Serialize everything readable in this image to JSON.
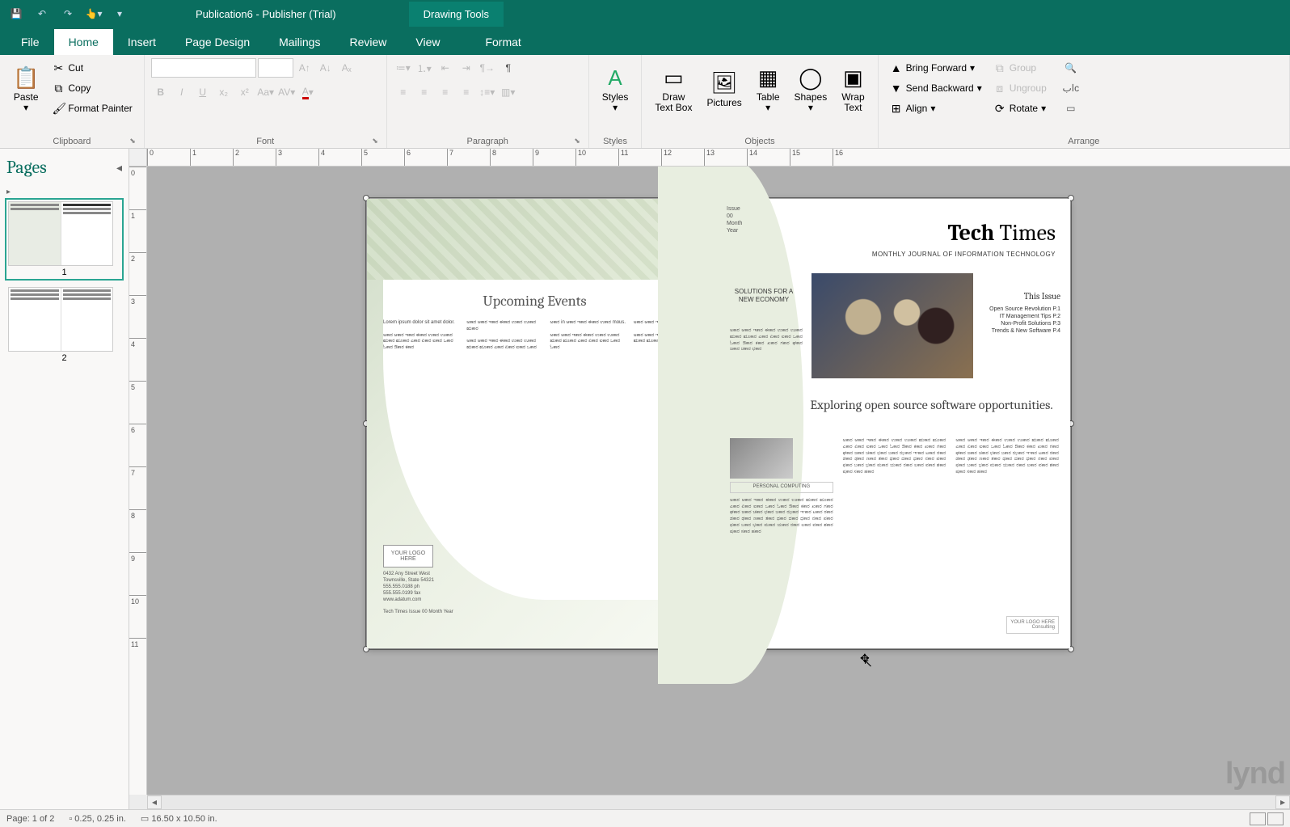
{
  "title": "Publication6 - Publisher (Trial)",
  "context_tab": "Drawing Tools",
  "tabs": {
    "file": "File",
    "home": "Home",
    "insert": "Insert",
    "page_design": "Page Design",
    "mailings": "Mailings",
    "review": "Review",
    "view": "View",
    "format": "Format"
  },
  "ribbon": {
    "clipboard": {
      "label": "Clipboard",
      "paste": "Paste",
      "cut": "Cut",
      "copy": "Copy",
      "format_painter": "Format Painter"
    },
    "font": {
      "label": "Font"
    },
    "paragraph": {
      "label": "Paragraph"
    },
    "styles": {
      "label": "Styles",
      "styles_btn": "Styles"
    },
    "objects": {
      "label": "Objects",
      "draw_text_box": "Draw\nText Box",
      "pictures": "Pictures",
      "table": "Table",
      "shapes": "Shapes",
      "wrap_text": "Wrap\nText"
    },
    "arrange": {
      "label": "Arrange",
      "bring_forward": "Bring Forward",
      "send_backward": "Send Backward",
      "align": "Align",
      "group": "Group",
      "ungroup": "Ungroup",
      "rotate": "Rotate"
    }
  },
  "pages_panel": {
    "title": "Pages",
    "page1_num": "1",
    "page2_num": "2"
  },
  "statusbar": {
    "page": "Page: 1 of 2",
    "pos": "0.25, 0.25 in.",
    "size": "16.50 x 10.50 in."
  },
  "ruler_h": [
    "0",
    "1",
    "2",
    "3",
    "4",
    "5",
    "6",
    "7",
    "8",
    "9",
    "10",
    "11",
    "12",
    "13",
    "14",
    "15",
    "16"
  ],
  "ruler_v": [
    "0",
    "1",
    "2",
    "3",
    "4",
    "5",
    "6",
    "7",
    "8",
    "9",
    "10",
    "11"
  ],
  "pub": {
    "left": {
      "upcoming": "Upcoming Events",
      "col1a": "Lorem ipsum dolor sit amet dolor.",
      "col1b": "ಅಕಾರ ಆಕಾರ ಇಕಾರ ಈಕಾರ ಉಕಾರ ಊಕಾರ ಋಕಾರ ೠಕಾರ ಎಕಾರ ಏಕಾರ ಐಕಾರ ಒಕಾರ ಓಕಾರ ಔಕಾರ ಕಕಾರ",
      "col2a": "ಅಕಾರ ಆಕಾರ ಇಕಾರ ಈಕಾರ ಉಕಾರ ಊಕಾರ ಋಕಾರ",
      "col2b": "ಅಕಾರ ಆಕಾರ ಇಕಾರ ಈಕಾರ ಉಕಾರ ಊಕಾರ ಋಕಾರ ೠಕಾರ ಎಕಾರ ಏಕಾರ ಐಕಾರ ಒಕಾರ",
      "col3a": "ಅಕಾರ in ಆಕಾರ ಇಕಾರ ಈಕಾರ ಉಕಾರ mous.",
      "col3b": "ಅಕಾರ ಆಕಾರ ಇಕಾರ ಈಕಾರ ಉಕಾರ ಊಕಾರ ಋಕಾರ ೠಕಾರ ಎಕಾರ ಏಕಾರ ಐಕಾರ ಒಕಾರ ಓಕಾರ",
      "col4a": "ಅಕಾರ ಆಕಾರ ಇಕಾರ ಈಕಾರ ಉಕಾರ ipsum.",
      "col4b": "ಅಕಾರ ಆಕಾರ ಇಕಾರ ಈಕಾರ ಉಕಾರ ಊಕಾರ ಋಕಾರ ೠಕಾರ ಎಕಾರ ಏಕಾರ",
      "logo": "YOUR LOGO HERE",
      "addr": "0432 Any Street West\nTownsville, State 54321\n555.555.0188 ph\n555.555.0199 fax\nwww.adatum.com",
      "footer": "Tech Times Issue 00 Month Year"
    },
    "right": {
      "issue": "Issue\n00\nMonth\nYear",
      "name_bold": "Tech",
      "name_light": "Times",
      "sub": "MONTHLY JOURNAL OF INFORMATION TECHNOLOGY",
      "this_issue": "This Issue",
      "toc1": "Open Source Revolution  P.1",
      "toc2": "IT Management Tips  P.2",
      "toc3": "Non-Profit Solutions  P.3",
      "toc4": "Trends & New Software  P.4",
      "solutions": "SOLUTIONS FOR A NEW ECONOMY",
      "sidebody": "ಅಕಾರ ಆಕಾರ ಇಕಾರ ಈಕಾರ ಉಕಾರ ಊಕಾರ ಋಕಾರ ೠಕಾರ ಎಕಾರ ಏಕಾರ ಐಕಾರ ಒಕಾರ ಓಕಾರ ಔಕಾರ ಕಕಾರ ಖಕಾರ ಗಕಾರ ಘಕಾರ ಙಕಾರ ಚಕಾರ ಛಕಾರ",
      "article_title": "Exploring open source software opportunities.",
      "caption": "PERSONAL COMPUTING",
      "body_col": "ಅಕಾರ ಆಕಾರ ಇಕಾರ ಈಕಾರ ಉಕಾರ ಊಕಾರ ಋಕಾರ ೠಕಾರ ಎಕಾರ ಏಕಾರ ಐಕಾರ ಒಕಾರ ಓಕಾರ ಔಕಾರ ಕಕಾರ ಖಕಾರ ಗಕಾರ ಘಕಾರ ಙಕಾರ ಚಕಾರ ಛಕಾರ ಜಕಾರ ಝಕಾರ ಞಕಾರ ಟಕಾರ ಠಕಾರ ಡಕಾರ ಢಕಾರ ಣಕಾರ ತಕಾರ ಥಕಾರ ದಕಾರ ಧಕಾರ ನಕಾರ ಪಕಾರ ಫಕಾರ ಬಕಾರ ಭಕಾರ ಮಕಾರ ಯಕಾರ ರಕಾರ ಲಕಾರ ವಕಾರ ಶಕಾರ ಷಕಾರ ಸಕಾರ ಹಕಾರ",
      "logo_br": "YOUR LOGO HERE",
      "consulting": "Consulting"
    }
  },
  "watermark": "lynd"
}
